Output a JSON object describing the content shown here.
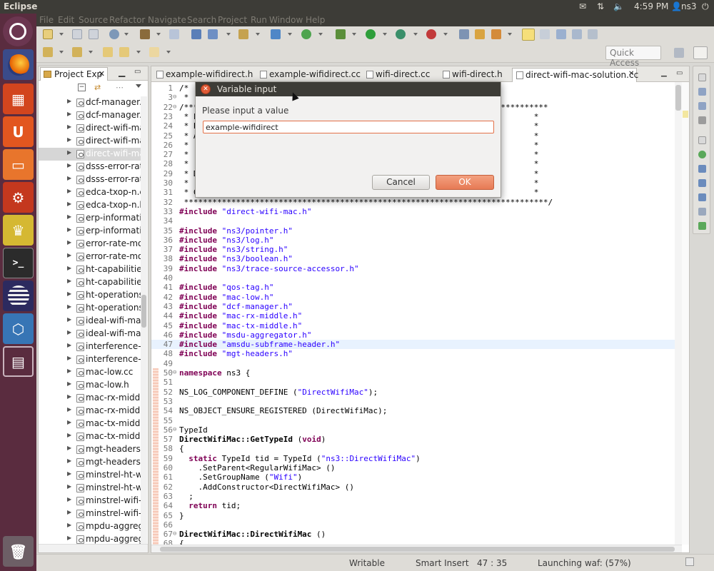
{
  "topbar": {
    "app_title": "Eclipse",
    "time": "4:59 PM",
    "user": "ns3"
  },
  "menubar": {
    "items": [
      "File",
      "Edit",
      "Source",
      "Refactor",
      "Navigate",
      "Search",
      "Project",
      "Run",
      "Window",
      "Help"
    ]
  },
  "toolbar": {
    "quick_access": "Quick Access"
  },
  "project_explorer": {
    "title": "Project Exp",
    "items": [
      "dcf-manager.cc",
      "dcf-manager.h",
      "direct-wifi-mac",
      "direct-wifi-mac",
      "direct-wifi-mac",
      "dsss-error-rate",
      "dsss-error-rate",
      "edca-txop-n.cc",
      "edca-txop-n.h",
      "erp-information",
      "erp-information",
      "error-rate-mod",
      "error-rate-mod",
      "ht-capabilities.",
      "ht-capabilities.",
      "ht-operations.c",
      "ht-operations.l",
      "ideal-wifi-mana",
      "ideal-wifi-mana",
      "interference-he",
      "interference-he",
      "mac-low.cc",
      "mac-low.h",
      "mac-rx-middle",
      "mac-rx-middle",
      "mac-tx-middle",
      "mac-tx-middle",
      "mgt-headers.cc",
      "mgt-headers.h",
      "minstrel-ht-wif",
      "minstrel-ht-wif",
      "minstrel-wifi-m",
      "minstrel-wifi-m",
      "mpdu-aggrega",
      "mpdu-aggrega"
    ],
    "selected_index": 4
  },
  "editor": {
    "tabs": [
      "example-wifidirect.h",
      "example-wifidirect.cc",
      "wifi-direct.cc",
      "wifi-direct.h",
      "direct-wifi-mac-solution.cc"
    ],
    "active_tab": 4,
    "lines": [
      {
        "n": "1",
        "t": "/*"
      },
      {
        "n": "3",
        "t": " *"
      },
      {
        "n": "22",
        "t": "/*****************************************************************************"
      },
      {
        "n": "23",
        "t": " * F                                                                       *"
      },
      {
        "n": "24",
        "t": " * P                                                                       *"
      },
      {
        "n": "25",
        "t": " * A                                                                       *"
      },
      {
        "n": "26",
        "t": " *                                                                         *"
      },
      {
        "n": "27",
        "t": " *                                                                         *"
      },
      {
        "n": "28",
        "t": " *                                                                         *"
      },
      {
        "n": "29",
        "t": " * D                                                                       *"
      },
      {
        "n": "30",
        "t": " *                                                                         *"
      },
      {
        "n": "31",
        "t": " * C                                                                       *"
      },
      {
        "n": "32",
        "t": " *****************************************************************************/"
      },
      {
        "n": "33",
        "t": "#include \"direct-wifi-mac.h\""
      },
      {
        "n": "34",
        "t": ""
      },
      {
        "n": "35",
        "t": "#include \"ns3/pointer.h\""
      },
      {
        "n": "36",
        "t": "#include \"ns3/log.h\""
      },
      {
        "n": "37",
        "t": "#include \"ns3/string.h\""
      },
      {
        "n": "38",
        "t": "#include \"ns3/boolean.h\""
      },
      {
        "n": "39",
        "t": "#include \"ns3/trace-source-accessor.h\""
      },
      {
        "n": "40",
        "t": ""
      },
      {
        "n": "41",
        "t": "#include \"qos-tag.h\""
      },
      {
        "n": "42",
        "t": "#include \"mac-low.h\""
      },
      {
        "n": "43",
        "t": "#include \"dcf-manager.h\""
      },
      {
        "n": "44",
        "t": "#include \"mac-rx-middle.h\""
      },
      {
        "n": "45",
        "t": "#include \"mac-tx-middle.h\""
      },
      {
        "n": "46",
        "t": "#include \"msdu-aggregator.h\""
      },
      {
        "n": "47",
        "t": "#include \"amsdu-subframe-header.h\""
      },
      {
        "n": "48",
        "t": "#include \"mgt-headers.h\""
      },
      {
        "n": "49",
        "t": ""
      },
      {
        "n": "50",
        "t": "namespace ns3 {"
      },
      {
        "n": "51",
        "t": ""
      },
      {
        "n": "52",
        "t": "NS_LOG_COMPONENT_DEFINE (\"DirectWifiMac\");"
      },
      {
        "n": "53",
        "t": ""
      },
      {
        "n": "54",
        "t": "NS_OBJECT_ENSURE_REGISTERED (DirectWifiMac);"
      },
      {
        "n": "55",
        "t": ""
      },
      {
        "n": "56",
        "t": "TypeId"
      },
      {
        "n": "57",
        "t": "DirectWifiMac::GetTypeId (void)"
      },
      {
        "n": "58",
        "t": "{"
      },
      {
        "n": "59",
        "t": "  static TypeId tid = TypeId (\"ns3::DirectWifiMac\")"
      },
      {
        "n": "60",
        "t": "    .SetParent<RegularWifiMac> ()"
      },
      {
        "n": "61",
        "t": "    .SetGroupName (\"Wifi\")"
      },
      {
        "n": "62",
        "t": "    .AddConstructor<DirectWifiMac> ()"
      },
      {
        "n": "63",
        "t": "  ;"
      },
      {
        "n": "64",
        "t": "  return tid;"
      },
      {
        "n": "65",
        "t": "}"
      },
      {
        "n": "66",
        "t": ""
      },
      {
        "n": "67",
        "t": "DirectWifiMac::DirectWifiMac ()"
      },
      {
        "n": "68",
        "t": "{"
      }
    ],
    "highlight_line": "47"
  },
  "status": {
    "writable": "Writable",
    "insert_mode": "Smart Insert",
    "position": "47 : 35",
    "progress": "Launching waf: (57%)"
  },
  "dialog": {
    "title": "Variable input",
    "message": "Please input a value",
    "value": "example-wifidirect",
    "cancel": "Cancel",
    "ok": "OK"
  }
}
